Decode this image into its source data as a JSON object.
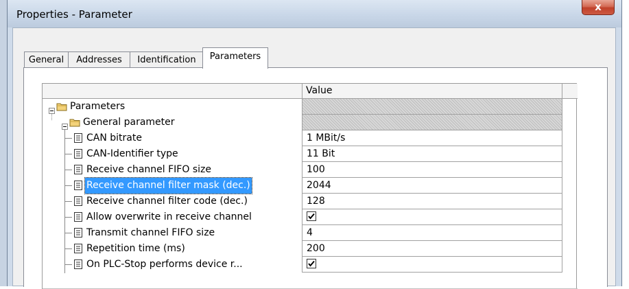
{
  "window": {
    "title": "Properties - Parameter",
    "close_glyph": "x"
  },
  "tabs": [
    {
      "label": "General",
      "active": false
    },
    {
      "label": "Addresses",
      "active": false
    },
    {
      "label": "Identification",
      "active": false
    },
    {
      "label": "Parameters",
      "active": true
    }
  ],
  "grid": {
    "header": {
      "name": "",
      "value": "Value"
    },
    "rows": [
      {
        "name": "Parameters",
        "value": "",
        "icon": "folder-icon",
        "level": 0,
        "expanded": true
      },
      {
        "name": "General parameter",
        "value": "",
        "icon": "folder-icon",
        "level": 1,
        "expanded": true
      },
      {
        "name": "CAN bitrate",
        "value": "1 MBit/s",
        "icon": "parameter-icon",
        "level": 2
      },
      {
        "name": "CAN-Identifier type",
        "value": "11 Bit",
        "icon": "parameter-icon",
        "level": 2
      },
      {
        "name": "Receive channel FIFO size",
        "value": "100",
        "icon": "parameter-icon",
        "level": 2
      },
      {
        "name": "Receive channel filter mask (dec.)",
        "value": "2044",
        "icon": "parameter-icon",
        "level": 2,
        "selected": true
      },
      {
        "name": "Receive channel filter code (dec.)",
        "value": "128",
        "icon": "parameter-icon",
        "level": 2
      },
      {
        "name": "Allow overwrite in receive channel",
        "value": "checked",
        "icon": "parameter-icon",
        "level": 2,
        "checkbox": true
      },
      {
        "name": "Transmit channel FIFO size",
        "value": "4",
        "icon": "parameter-icon",
        "level": 2
      },
      {
        "name": "Repetition time (ms)",
        "value": "200",
        "icon": "parameter-icon",
        "level": 2
      },
      {
        "name": "On PLC-Stop performs device r...",
        "value": "checked",
        "icon": "parameter-icon",
        "level": 2,
        "checkbox": true
      }
    ]
  },
  "colors": {
    "selection": "#3399ff",
    "close": "#c0412a"
  }
}
